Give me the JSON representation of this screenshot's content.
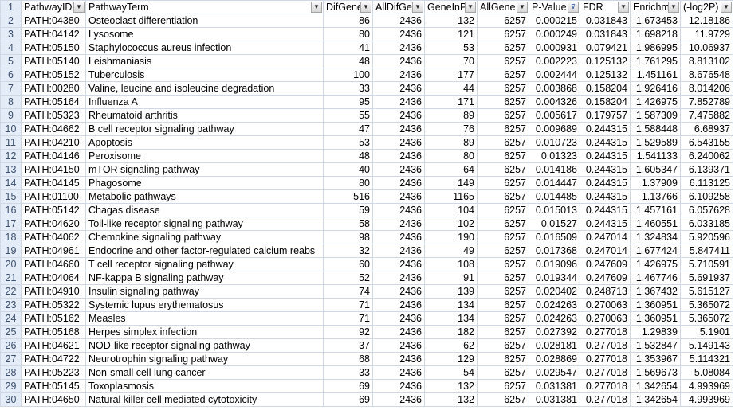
{
  "headers": [
    {
      "label": "PathwayID",
      "filter": "▼"
    },
    {
      "label": "PathwayTerm",
      "filter": "▼"
    },
    {
      "label": "DifGene",
      "filter": "▼"
    },
    {
      "label": "AllDifGe",
      "filter": "▼"
    },
    {
      "label": "GeneInP",
      "filter": "▼"
    },
    {
      "label": "AllGene",
      "filter": "▼"
    },
    {
      "label": "P-Value",
      "filter": "⊽"
    },
    {
      "label": "FDR",
      "filter": "▼"
    },
    {
      "label": "Enrichm",
      "filter": "▼"
    },
    {
      "label": "(-log2P)",
      "filter": "▼"
    }
  ],
  "rows": [
    [
      "2",
      "PATH:04380",
      "Osteoclast differentiation",
      "86",
      "2436",
      "132",
      "6257",
      "0.000215",
      "0.031843",
      "1.673453",
      "12.18186"
    ],
    [
      "3",
      "PATH:04142",
      "Lysosome",
      "80",
      "2436",
      "121",
      "6257",
      "0.000249",
      "0.031843",
      "1.698218",
      "11.9729"
    ],
    [
      "4",
      "PATH:05150",
      "Staphylococcus aureus infection",
      "41",
      "2436",
      "53",
      "6257",
      "0.000931",
      "0.079421",
      "1.986995",
      "10.06937"
    ],
    [
      "5",
      "PATH:05140",
      "Leishmaniasis",
      "48",
      "2436",
      "70",
      "6257",
      "0.002223",
      "0.125132",
      "1.761295",
      "8.813102"
    ],
    [
      "6",
      "PATH:05152",
      "Tuberculosis",
      "100",
      "2436",
      "177",
      "6257",
      "0.002444",
      "0.125132",
      "1.451161",
      "8.676548"
    ],
    [
      "7",
      "PATH:00280",
      "Valine, leucine and isoleucine degradation",
      "33",
      "2436",
      "44",
      "6257",
      "0.003868",
      "0.158204",
      "1.926416",
      "8.014206"
    ],
    [
      "8",
      "PATH:05164",
      "Influenza A",
      "95",
      "2436",
      "171",
      "6257",
      "0.004326",
      "0.158204",
      "1.426975",
      "7.852789"
    ],
    [
      "9",
      "PATH:05323",
      "Rheumatoid arthritis",
      "55",
      "2436",
      "89",
      "6257",
      "0.005617",
      "0.179757",
      "1.587309",
      "7.475882"
    ],
    [
      "10",
      "PATH:04662",
      "B cell receptor signaling pathway",
      "47",
      "2436",
      "76",
      "6257",
      "0.009689",
      "0.244315",
      "1.588448",
      "6.68937"
    ],
    [
      "11",
      "PATH:04210",
      "Apoptosis",
      "53",
      "2436",
      "89",
      "6257",
      "0.010723",
      "0.244315",
      "1.529589",
      "6.543155"
    ],
    [
      "12",
      "PATH:04146",
      "Peroxisome",
      "48",
      "2436",
      "80",
      "6257",
      "0.01323",
      "0.244315",
      "1.541133",
      "6.240062"
    ],
    [
      "13",
      "PATH:04150",
      "mTOR signaling pathway",
      "40",
      "2436",
      "64",
      "6257",
      "0.014186",
      "0.244315",
      "1.605347",
      "6.139371"
    ],
    [
      "14",
      "PATH:04145",
      "Phagosome",
      "80",
      "2436",
      "149",
      "6257",
      "0.014447",
      "0.244315",
      "1.37909",
      "6.113125"
    ],
    [
      "15",
      "PATH:01100",
      "Metabolic pathways",
      "516",
      "2436",
      "1165",
      "6257",
      "0.014485",
      "0.244315",
      "1.13766",
      "6.109258"
    ],
    [
      "16",
      "PATH:05142",
      "Chagas disease",
      "59",
      "2436",
      "104",
      "6257",
      "0.015013",
      "0.244315",
      "1.457161",
      "6.057628"
    ],
    [
      "17",
      "PATH:04620",
      "Toll-like receptor signaling pathway",
      "58",
      "2436",
      "102",
      "6257",
      "0.01527",
      "0.244315",
      "1.460551",
      "6.033185"
    ],
    [
      "18",
      "PATH:04062",
      "Chemokine signaling pathway",
      "98",
      "2436",
      "190",
      "6257",
      "0.016509",
      "0.247014",
      "1.324834",
      "5.920596"
    ],
    [
      "19",
      "PATH:04961",
      "Endocrine and other factor-regulated calcium reabs",
      "32",
      "2436",
      "49",
      "6257",
      "0.017368",
      "0.247014",
      "1.677424",
      "5.847411"
    ],
    [
      "20",
      "PATH:04660",
      "T cell receptor signaling pathway",
      "60",
      "2436",
      "108",
      "6257",
      "0.019096",
      "0.247609",
      "1.426975",
      "5.710591"
    ],
    [
      "21",
      "PATH:04064",
      "NF-kappa B signaling pathway",
      "52",
      "2436",
      "91",
      "6257",
      "0.019344",
      "0.247609",
      "1.467746",
      "5.691937"
    ],
    [
      "22",
      "PATH:04910",
      "Insulin signaling pathway",
      "74",
      "2436",
      "139",
      "6257",
      "0.020402",
      "0.248713",
      "1.367432",
      "5.615127"
    ],
    [
      "23",
      "PATH:05322",
      "Systemic lupus erythematosus",
      "71",
      "2436",
      "134",
      "6257",
      "0.024263",
      "0.270063",
      "1.360951",
      "5.365072"
    ],
    [
      "24",
      "PATH:05162",
      "Measles",
      "71",
      "2436",
      "134",
      "6257",
      "0.024263",
      "0.270063",
      "1.360951",
      "5.365072"
    ],
    [
      "25",
      "PATH:05168",
      "Herpes simplex infection",
      "92",
      "2436",
      "182",
      "6257",
      "0.027392",
      "0.277018",
      "1.29839",
      "5.1901"
    ],
    [
      "26",
      "PATH:04621",
      "NOD-like receptor signaling pathway",
      "37",
      "2436",
      "62",
      "6257",
      "0.028181",
      "0.277018",
      "1.532847",
      "5.149143"
    ],
    [
      "27",
      "PATH:04722",
      "Neurotrophin signaling pathway",
      "68",
      "2436",
      "129",
      "6257",
      "0.028869",
      "0.277018",
      "1.353967",
      "5.114321"
    ],
    [
      "28",
      "PATH:05223",
      "Non-small cell lung cancer",
      "33",
      "2436",
      "54",
      "6257",
      "0.029547",
      "0.277018",
      "1.569673",
      "5.08084"
    ],
    [
      "29",
      "PATH:05145",
      "Toxoplasmosis",
      "69",
      "2436",
      "132",
      "6257",
      "0.031381",
      "0.277018",
      "1.342654",
      "4.993969"
    ],
    [
      "30",
      "PATH:04650",
      "Natural killer cell mediated cytotoxicity",
      "69",
      "2436",
      "132",
      "6257",
      "0.031381",
      "0.277018",
      "1.342654",
      "4.993969"
    ]
  ]
}
